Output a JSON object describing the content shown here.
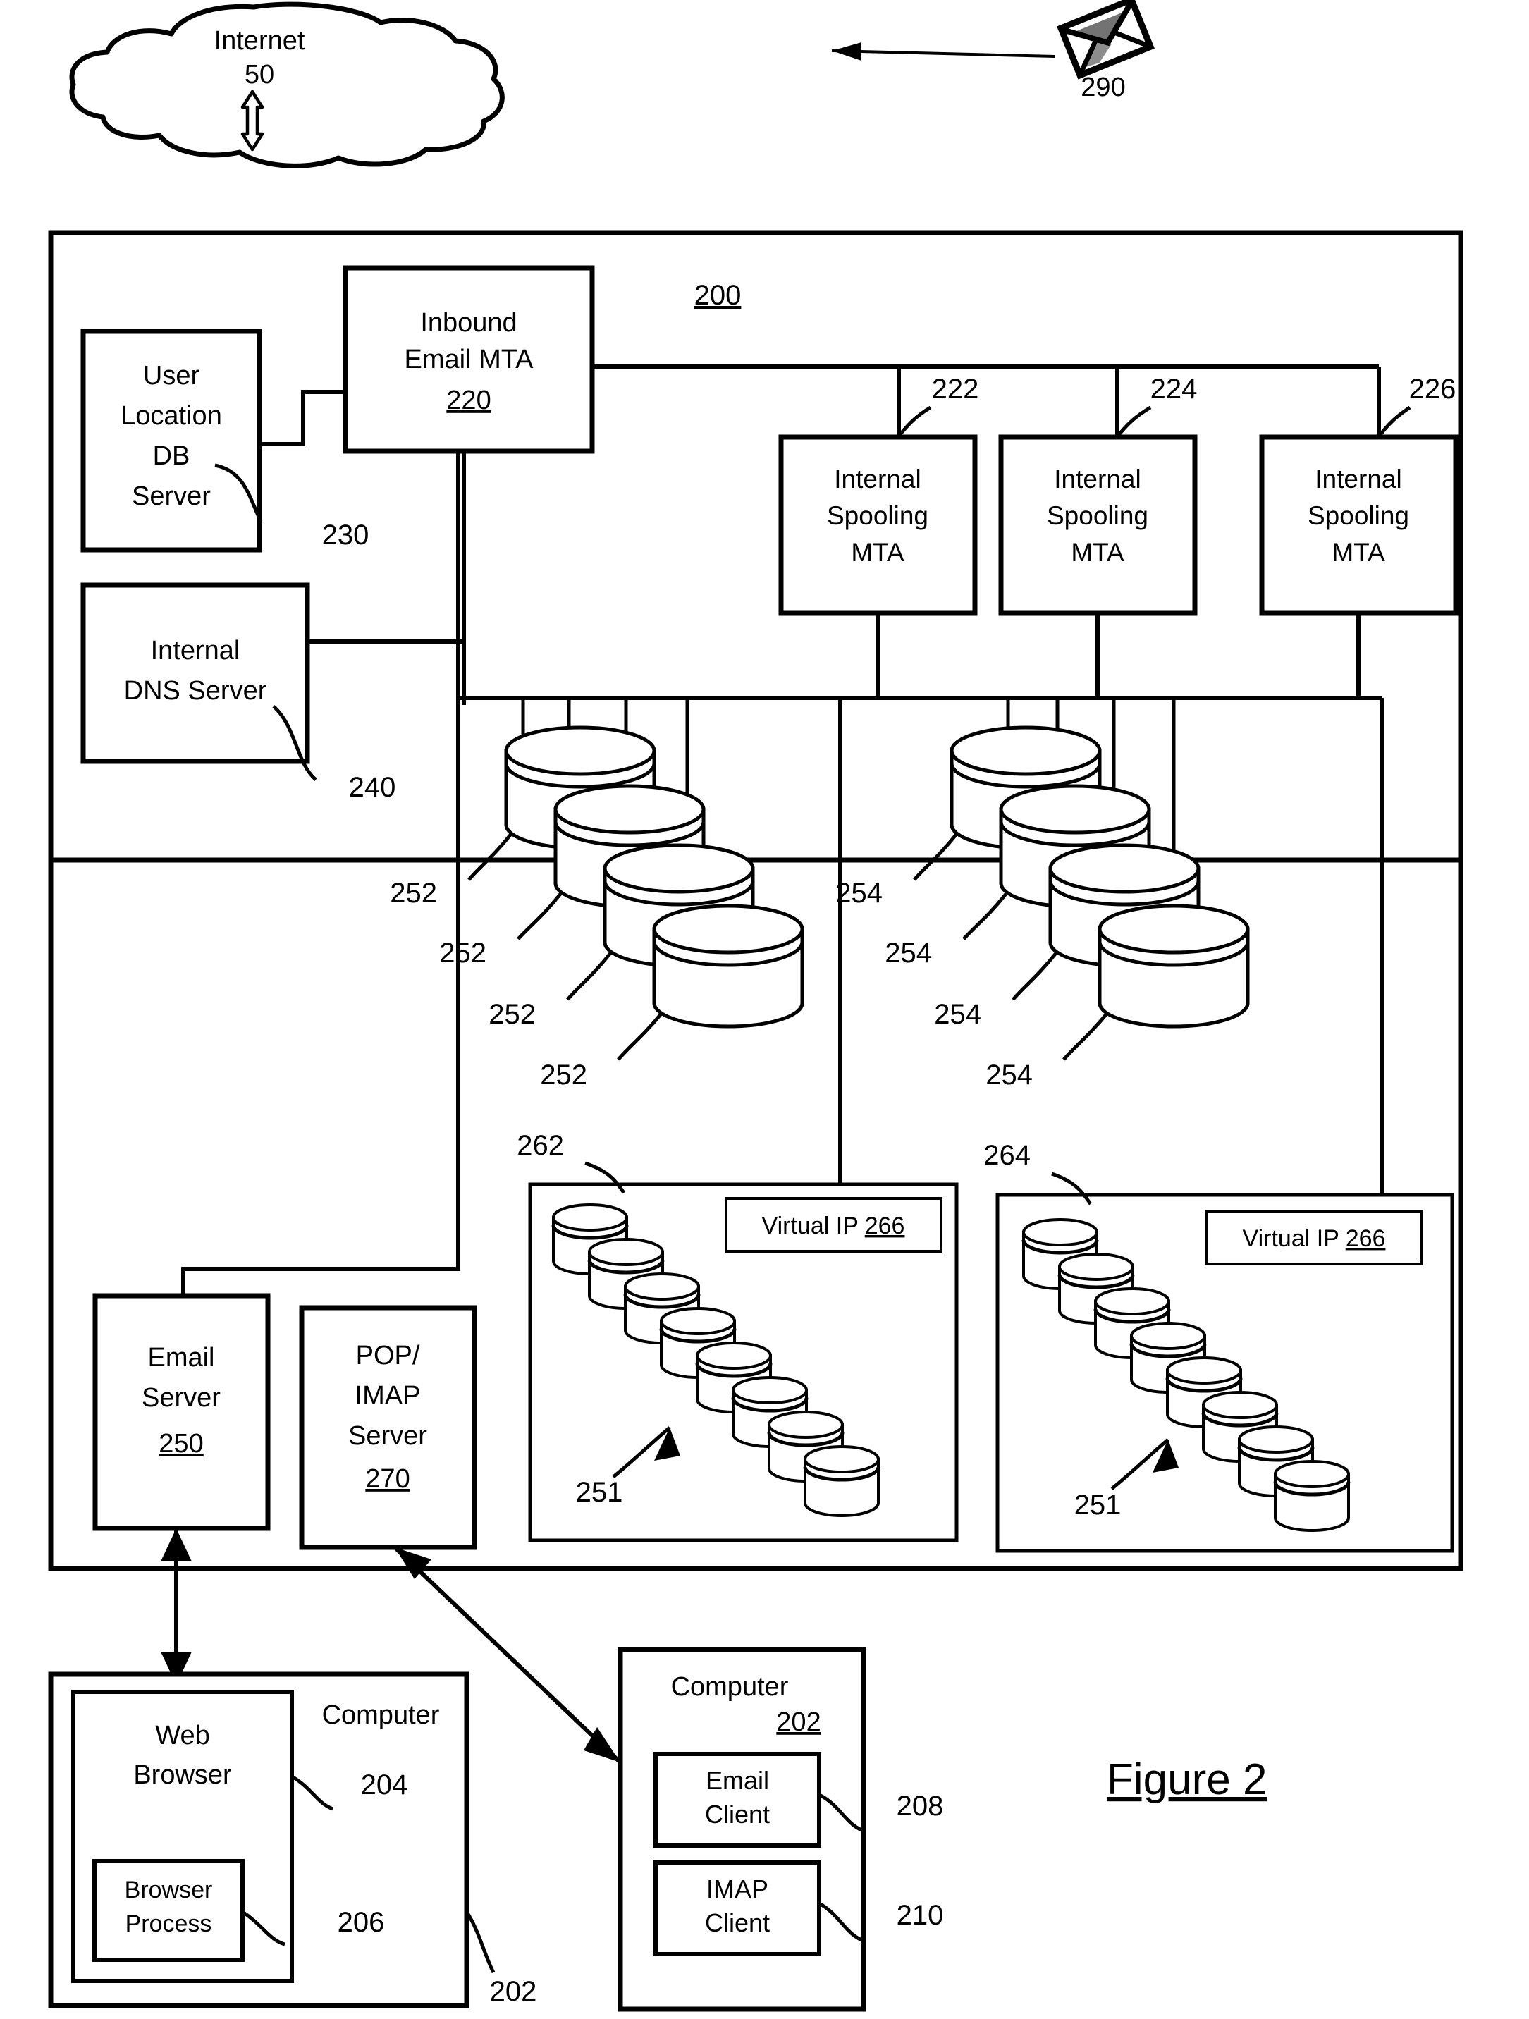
{
  "figure": {
    "caption": "Figure 2",
    "system_number": "200"
  },
  "cloud": {
    "name": "Internet",
    "number": "50"
  },
  "envelope": {
    "name": "email-envelope",
    "number": "290"
  },
  "boxes": {
    "inbound_mta": {
      "line1": "Inbound",
      "line2": "Email MTA",
      "number": "220"
    },
    "user_location_db": {
      "line1": "User",
      "line2": "Location",
      "line3": "DB",
      "line4": "Server",
      "number": "230"
    },
    "internal_dns": {
      "line1": "Internal",
      "line2": "DNS Server",
      "number": "240"
    },
    "email_server": {
      "line1": "Email",
      "line2": "Server",
      "number": "250"
    },
    "pop_imap_server": {
      "line1": "POP/",
      "line2": "IMAP",
      "line3": "Server",
      "number": "270"
    }
  },
  "spooling_mtas": [
    {
      "line1": "Internal",
      "line2": "Spooling",
      "line3": "MTA",
      "number": "222"
    },
    {
      "line1": "Internal",
      "line2": "Spooling",
      "line3": "MTA",
      "number": "224"
    },
    {
      "line1": "Internal",
      "line2": "Spooling",
      "line3": "MTA",
      "number": "226"
    }
  ],
  "store_labels_left": [
    "252",
    "252",
    "252",
    "252"
  ],
  "store_labels_right": [
    "254",
    "254",
    "254",
    "254"
  ],
  "clusters": [
    {
      "number": "262",
      "virtual_ip_label": "Virtual IP",
      "virtual_ip_number": "266",
      "disk_label": "251",
      "disk_count": 8
    },
    {
      "number": "264",
      "virtual_ip_label": "Virtual IP",
      "virtual_ip_number": "266",
      "disk_label": "251",
      "disk_count": 8
    }
  ],
  "computers": {
    "left": {
      "title": "Computer",
      "number": "202",
      "web_browser": {
        "line1": "Web",
        "line2": "Browser",
        "number": "204"
      },
      "browser_process": {
        "line1": "Browser",
        "line2": "Process",
        "number": "206"
      }
    },
    "right": {
      "title": "Computer",
      "number": "202",
      "email_client": {
        "line1": "Email",
        "line2": "Client",
        "number": "208"
      },
      "imap_client": {
        "line1": "IMAP",
        "line2": "Client",
        "number": "210"
      }
    }
  },
  "colors": {
    "ink": "#000000",
    "paper": "#ffffff"
  }
}
